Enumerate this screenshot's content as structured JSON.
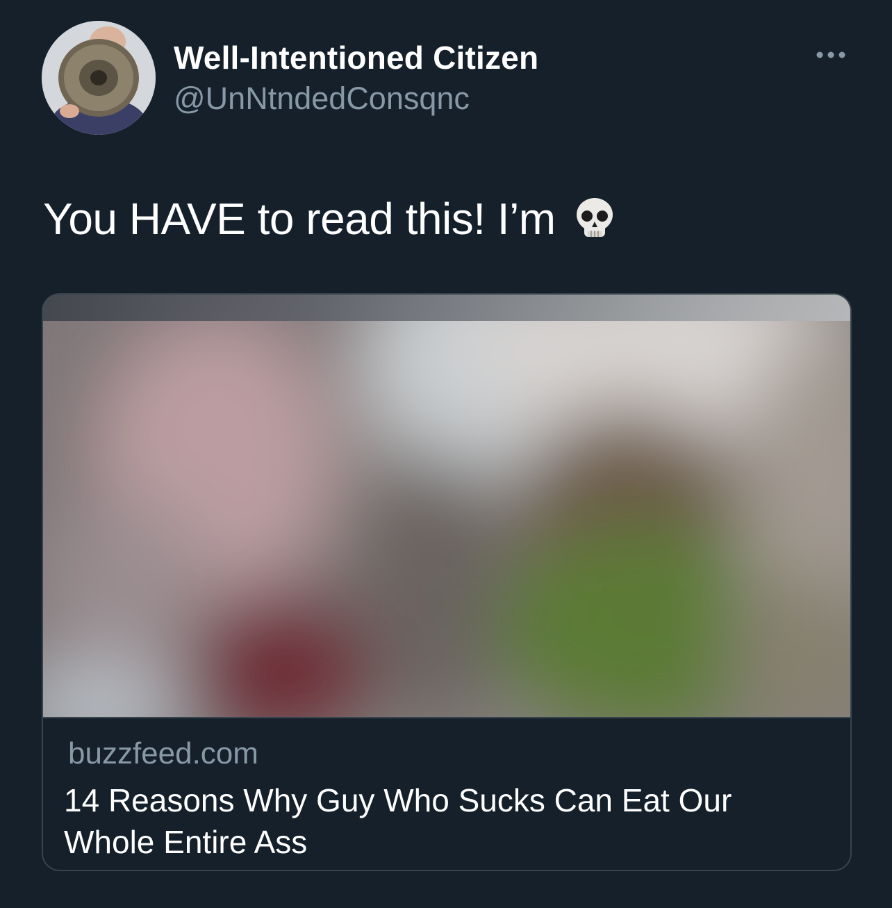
{
  "tweet": {
    "display_name": "Well-Intentioned Citizen",
    "handle": "@UnNtndedConsqnc",
    "text": "You HAVE to read this! I’m",
    "emoji_icon": "skull-icon",
    "more_icon": "more-options-icon"
  },
  "link_card": {
    "domain": "buzzfeed.com",
    "title": "14 Reasons Why Guy Who Sucks Can Eat Our Whole Entire Ass"
  },
  "colors": {
    "background": "#15202b",
    "primary_text": "#ffffff",
    "secondary_text": "#8899a6",
    "border": "#38444d"
  }
}
